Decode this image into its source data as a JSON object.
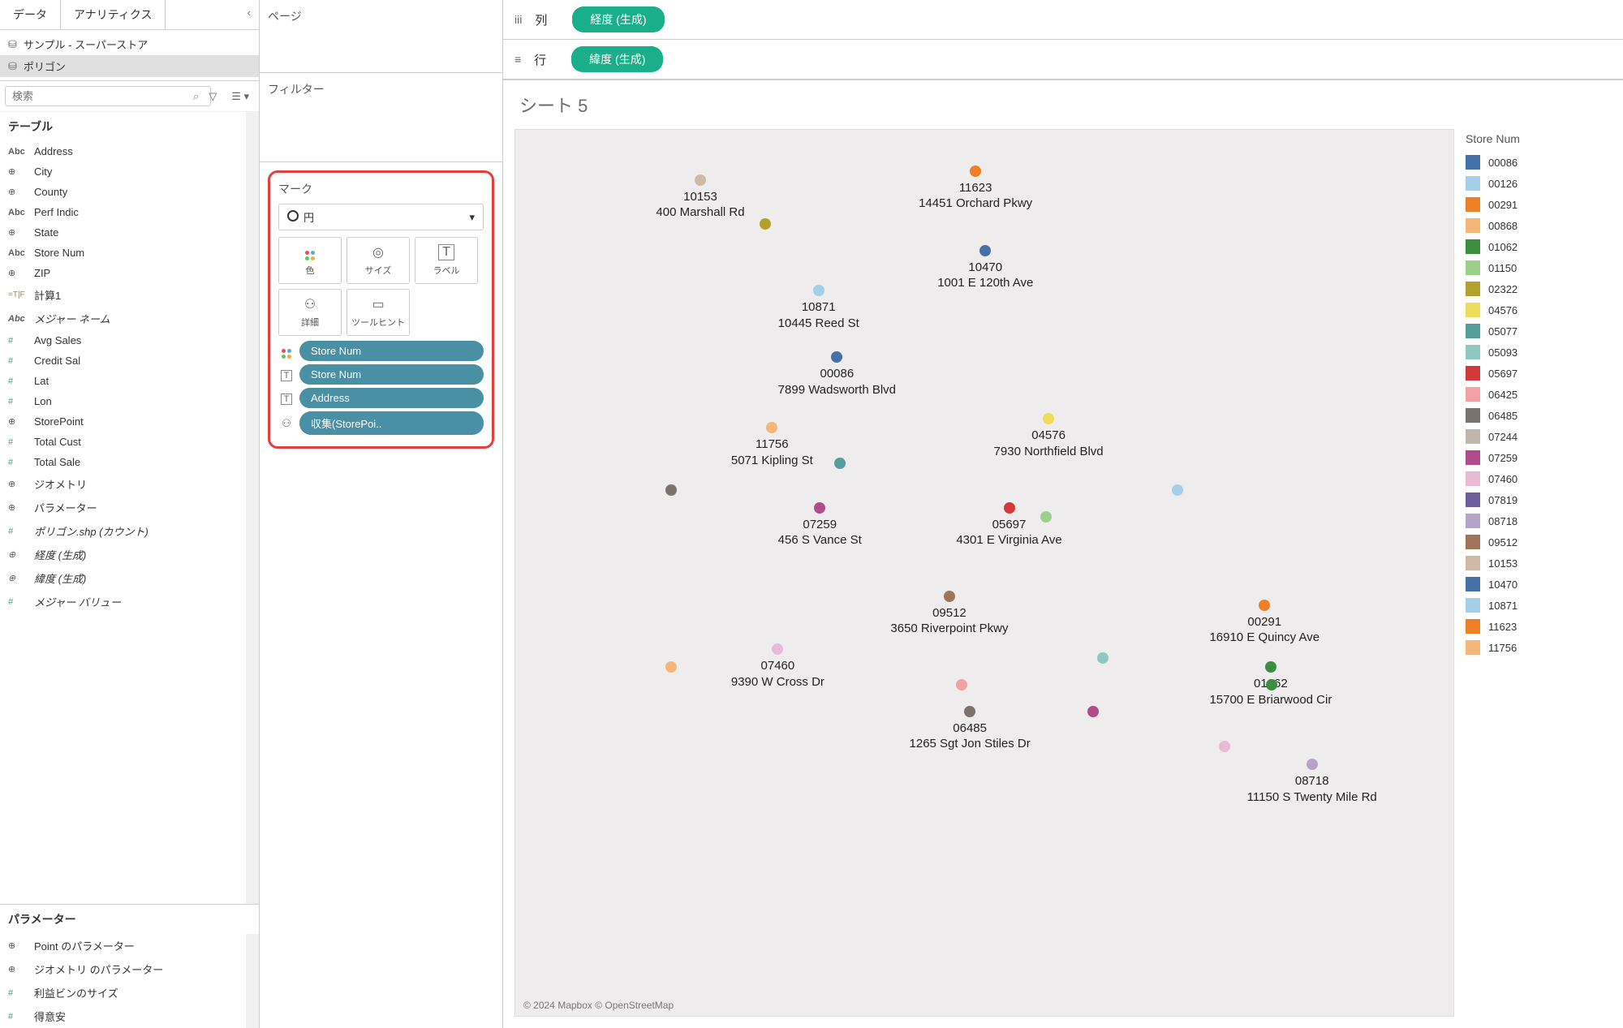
{
  "tabs": {
    "data": "データ",
    "analytics": "アナリティクス"
  },
  "datasources": {
    "sample": "サンプル - スーパーストア",
    "polygon": "ポリゴン"
  },
  "search": {
    "placeholder": "検索"
  },
  "tableHeader": "テーブル",
  "fields": [
    [
      "abc",
      "Address",
      false
    ],
    [
      "globe",
      "City",
      false
    ],
    [
      "globe",
      "County",
      false
    ],
    [
      "abc",
      "Perf Indic",
      false
    ],
    [
      "globe",
      "State",
      false
    ],
    [
      "abc",
      "Store Num",
      false
    ],
    [
      "globe",
      "ZIP",
      false
    ],
    [
      "calc",
      "計算1",
      false
    ],
    [
      "abc",
      "メジャー ネーム",
      true
    ],
    [
      "hash",
      "Avg Sales",
      false
    ],
    [
      "hash",
      "Credit Sal",
      false
    ],
    [
      "hash",
      "Lat",
      false
    ],
    [
      "hash",
      "Lon",
      false
    ],
    [
      "globe",
      "StorePoint",
      false
    ],
    [
      "hash",
      "Total Cust",
      false
    ],
    [
      "hash",
      "Total Sale",
      false
    ],
    [
      "globe",
      "ジオメトリ",
      false
    ],
    [
      "globe",
      "パラメーター",
      false
    ],
    [
      "hash",
      "ポリゴン.shp (カウント)",
      true
    ],
    [
      "globe",
      "経度 (生成)",
      true
    ],
    [
      "globe",
      "緯度 (生成)",
      true
    ],
    [
      "hash",
      "メジャー バリュー",
      true
    ]
  ],
  "paramHeader": "パラメーター",
  "params": [
    [
      "globe",
      "Point のパラメーター",
      false
    ],
    [
      "globe",
      "ジオメトリ のパラメーター",
      false
    ],
    [
      "hash",
      "利益ビンのサイズ",
      false
    ],
    [
      "hash",
      "得意安",
      false
    ]
  ],
  "shelves": {
    "pages": "ページ",
    "filters": "フィルター",
    "marks": "マーク",
    "columns": "列",
    "rows": "行"
  },
  "marksDropdown": "円",
  "markButtons": {
    "color": "色",
    "size": "サイズ",
    "label": "ラベル",
    "detail": "詳細",
    "tooltip": "ツールヒント"
  },
  "markPills": [
    [
      "dots",
      "Store Num"
    ],
    [
      "T",
      "Store Num"
    ],
    [
      "T",
      "Address"
    ],
    [
      "tree",
      "収集(StorePoi.."
    ]
  ],
  "colPill": "経度 (生成)",
  "rowPill": "緯度 (生成)",
  "sheetTitle": "シート 5",
  "mapAttr": "© 2024 Mapbox © OpenStreetMap",
  "legendTitle": "Store Num",
  "colors": {
    "00086": "#4472a8",
    "00126": "#a3cfe8",
    "00291": "#ef7f24",
    "00868": "#f5b779",
    "01062": "#3c8f3e",
    "01150": "#9bd08b",
    "02322": "#b2a22b",
    "04576": "#eedb5a",
    "05077": "#549e9a",
    "05093": "#8fc8c3",
    "05697": "#d53838",
    "06425": "#f2a1a5",
    "06485": "#7a726d",
    "07244": "#bfb7ae",
    "07259": "#b04c8c",
    "07460": "#e9bad4",
    "07819": "#6e5d9a",
    "08718": "#b4a5c8",
    "09512": "#a07458",
    "10153": "#d0b9a4",
    "10470": "#4472a8",
    "10871": "#a3cfe8",
    "11623": "#ef7f24",
    "11756": "#f5b779"
  },
  "legendOrder": [
    "00086",
    "00126",
    "00291",
    "00868",
    "01062",
    "01150",
    "02322",
    "04576",
    "05077",
    "05093",
    "05697",
    "06425",
    "06485",
    "07244",
    "07259",
    "07460",
    "07819",
    "08718",
    "09512",
    "10153",
    "10470",
    "10871",
    "11623",
    "11756"
  ],
  "chart_data": {
    "type": "scatter",
    "title": "シート 5",
    "points": [
      {
        "id": "10153",
        "addr": "400 Marshall Rd",
        "x": 15,
        "y": 5
      },
      {
        "id": "11623",
        "addr": "14451 Orchard Pkwy",
        "x": 43,
        "y": 4
      },
      {
        "id": "10470",
        "addr": "1001 E 120th Ave",
        "x": 45,
        "y": 13
      },
      {
        "id": "10871",
        "addr": "10445 Reed St",
        "x": 28,
        "y": 17.5
      },
      {
        "id": "00086",
        "addr": "7899 Wadsworth Blvd",
        "x": 28,
        "y": 25
      },
      {
        "id": "11756",
        "addr": "5071 Kipling St",
        "x": 23,
        "y": 33
      },
      {
        "id": "04576",
        "addr": "7930 Northfield Blvd",
        "x": 51,
        "y": 32
      },
      {
        "id": "07259",
        "addr": "456 S Vance St",
        "x": 28,
        "y": 42
      },
      {
        "id": "05697",
        "addr": "4301 E Virginia Ave",
        "x": 47,
        "y": 42
      },
      {
        "id": "09512",
        "addr": "3650 Riverpoint Pkwy",
        "x": 40,
        "y": 52
      },
      {
        "id": "00291",
        "addr": "16910 E Quincy Ave",
        "x": 74,
        "y": 53
      },
      {
        "id": "07460",
        "addr": "9390 W Cross Dr",
        "x": 23,
        "y": 58
      },
      {
        "id": "01062",
        "addr": "15700 E Briarwood Cir",
        "x": 74,
        "y": 60
      },
      {
        "id": "06485",
        "addr": "1265 Sgt Jon Stiles Dr",
        "x": 42,
        "y": 65
      },
      {
        "id": "08718",
        "addr": "11150 S Twenty Mile Rd",
        "x": 78,
        "y": 71
      }
    ],
    "extra_dots": [
      {
        "color": "#b2a22b",
        "x": 26,
        "y": 10
      },
      {
        "color": "#7a726d",
        "x": 16,
        "y": 40
      },
      {
        "color": "#549e9a",
        "x": 34,
        "y": 37
      },
      {
        "color": "#9bd08b",
        "x": 56,
        "y": 43
      },
      {
        "color": "#a3cfe8",
        "x": 70,
        "y": 40
      },
      {
        "color": "#f5b779",
        "x": 16,
        "y": 60
      },
      {
        "color": "#f2a1a5",
        "x": 47,
        "y": 62
      },
      {
        "color": "#8fc8c3",
        "x": 62,
        "y": 59
      },
      {
        "color": "#b04c8c",
        "x": 61,
        "y": 65
      },
      {
        "color": "#3c8f3e",
        "x": 80,
        "y": 62
      },
      {
        "color": "#e9bad4",
        "x": 75,
        "y": 69
      }
    ]
  }
}
